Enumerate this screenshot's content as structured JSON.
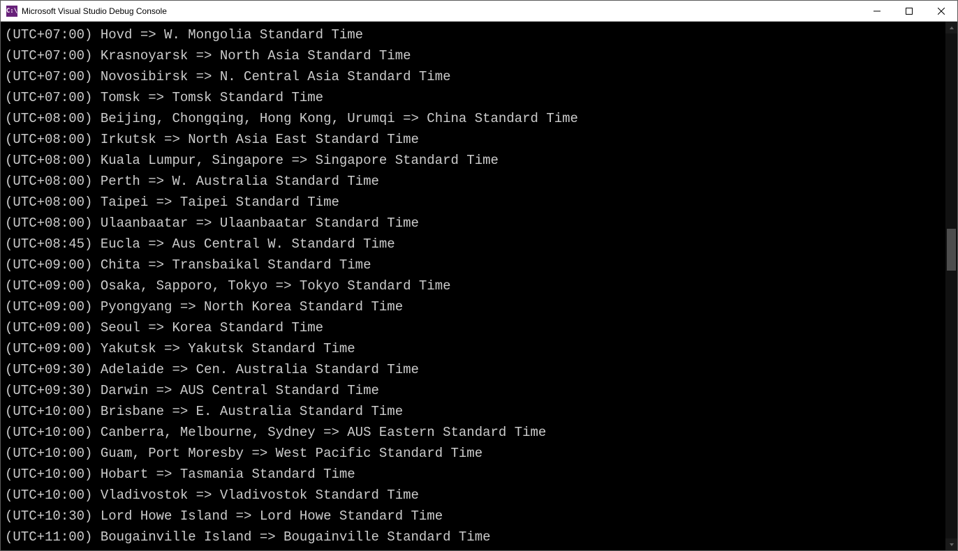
{
  "window": {
    "title": "Microsoft Visual Studio Debug Console",
    "icon_label": "C:\\"
  },
  "console": {
    "lines": [
      "(UTC+07:00) Hovd => W. Mongolia Standard Time",
      "(UTC+07:00) Krasnoyarsk => North Asia Standard Time",
      "(UTC+07:00) Novosibirsk => N. Central Asia Standard Time",
      "(UTC+07:00) Tomsk => Tomsk Standard Time",
      "(UTC+08:00) Beijing, Chongqing, Hong Kong, Urumqi => China Standard Time",
      "(UTC+08:00) Irkutsk => North Asia East Standard Time",
      "(UTC+08:00) Kuala Lumpur, Singapore => Singapore Standard Time",
      "(UTC+08:00) Perth => W. Australia Standard Time",
      "(UTC+08:00) Taipei => Taipei Standard Time",
      "(UTC+08:00) Ulaanbaatar => Ulaanbaatar Standard Time",
      "(UTC+08:45) Eucla => Aus Central W. Standard Time",
      "(UTC+09:00) Chita => Transbaikal Standard Time",
      "(UTC+09:00) Osaka, Sapporo, Tokyo => Tokyo Standard Time",
      "(UTC+09:00) Pyongyang => North Korea Standard Time",
      "(UTC+09:00) Seoul => Korea Standard Time",
      "(UTC+09:00) Yakutsk => Yakutsk Standard Time",
      "(UTC+09:30) Adelaide => Cen. Australia Standard Time",
      "(UTC+09:30) Darwin => AUS Central Standard Time",
      "(UTC+10:00) Brisbane => E. Australia Standard Time",
      "(UTC+10:00) Canberra, Melbourne, Sydney => AUS Eastern Standard Time",
      "(UTC+10:00) Guam, Port Moresby => West Pacific Standard Time",
      "(UTC+10:00) Hobart => Tasmania Standard Time",
      "(UTC+10:00) Vladivostok => Vladivostok Standard Time",
      "(UTC+10:30) Lord Howe Island => Lord Howe Standard Time",
      "(UTC+11:00) Bougainville Island => Bougainville Standard Time"
    ]
  }
}
